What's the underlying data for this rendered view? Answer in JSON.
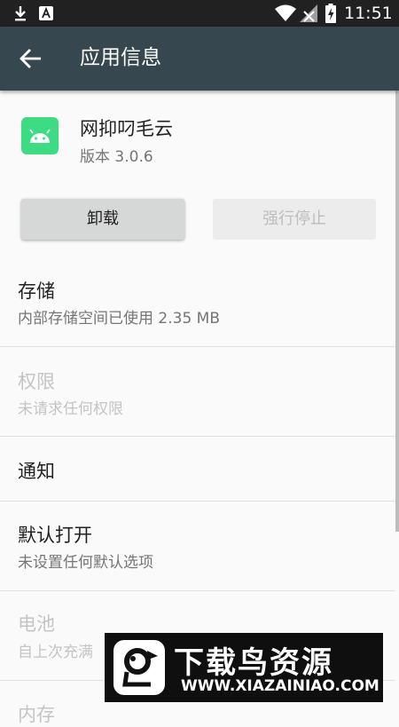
{
  "status_bar": {
    "time": "11:51",
    "left_icons": [
      "download-icon",
      "text-a-icon"
    ],
    "right_icons": [
      "wifi-icon",
      "no-signal-icon",
      "battery-charging-icon"
    ]
  },
  "app_bar": {
    "title": "应用信息",
    "back_icon": "arrow-back-icon",
    "color": "#37474f"
  },
  "app": {
    "name": "网抑叼毛云",
    "version": "版本 3.0.6",
    "icon": "android-icon",
    "icon_color": "#3ddc84"
  },
  "buttons": {
    "uninstall": "卸载",
    "force_stop": "强行停止"
  },
  "settings": [
    {
      "title": "存储",
      "subtitle": "内部存储空间已使用 2.35 MB",
      "enabled": true
    },
    {
      "title": "权限",
      "subtitle": "未请求任何权限",
      "enabled": false
    },
    {
      "title": "通知",
      "subtitle": "",
      "enabled": true
    },
    {
      "title": "默认打开",
      "subtitle": "未设置任何默认选项",
      "enabled": true
    },
    {
      "title": "电池",
      "subtitle": "自上次充满",
      "enabled": false
    },
    {
      "title": "内存",
      "subtitle": "",
      "enabled": false
    }
  ],
  "watermark": {
    "title": "下载鸟资源",
    "url": "WWW.XIAZAINIAO.COM"
  }
}
